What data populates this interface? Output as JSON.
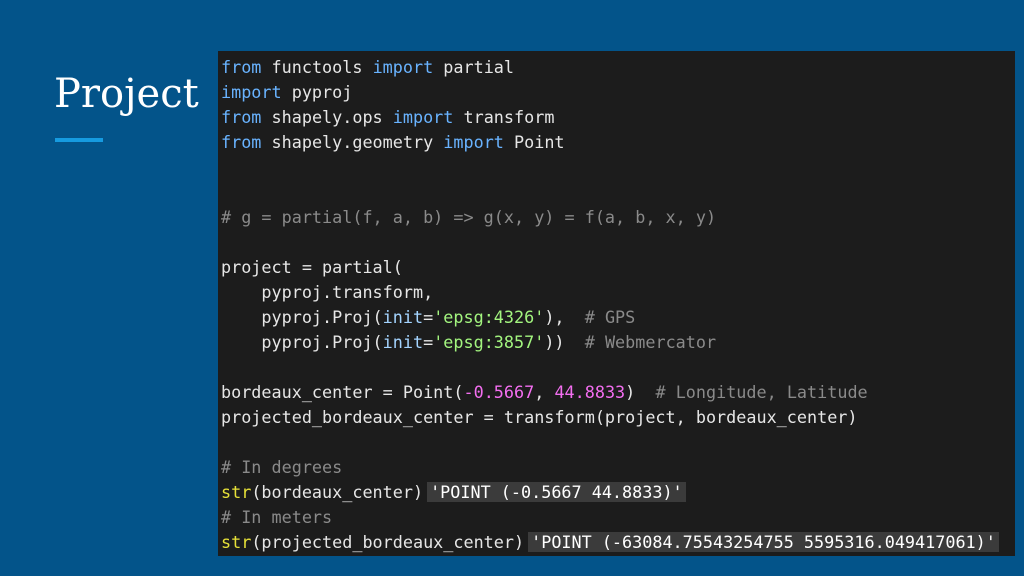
{
  "slide": {
    "title": "Project"
  },
  "code": {
    "line1": {
      "kw1": "from",
      "t1": " functools ",
      "kw2": "import",
      "t2": " partial"
    },
    "line2": {
      "kw1": "import",
      "t1": " pyproj"
    },
    "line3": {
      "kw1": "from",
      "t1": " shapely.ops ",
      "kw2": "import",
      "t2": " transform"
    },
    "line4": {
      "kw1": "from",
      "t1": " shapely.geometry ",
      "kw2": "import",
      "t2": " Point"
    },
    "line5": {
      "comment": "# g = partial(f, a, b) => g(x, y) = f(a, b, x, y)"
    },
    "line6": {
      "t1": "project = partial("
    },
    "line7": {
      "t1": "    pyproj.transform,"
    },
    "line8": {
      "t1": "    pyproj.Proj(",
      "arg": "init",
      "eq": "=",
      "str": "'epsg:4326'",
      "t2": "),  ",
      "comment": "# GPS"
    },
    "line9": {
      "t1": "    pyproj.Proj(",
      "arg": "init",
      "eq": "=",
      "str": "'epsg:3857'",
      "t2": "))  ",
      "comment": "# Webmercator"
    },
    "line10": {
      "t1": "bordeaux_center = Point(",
      "num1": "-0.5667",
      "sep": ", ",
      "num2": "44.8833",
      "t2": ")  ",
      "comment": "# Longitude, Latitude"
    },
    "line11": {
      "t1": "projected_bordeaux_center = transform(project, bordeaux_center)"
    },
    "line12": {
      "comment": "# In degrees"
    },
    "line13": {
      "fn": "str",
      "t1": "(bordeaux_center)",
      "out": "'POINT (-0.5667 44.8833)'"
    },
    "line14": {
      "comment": "# In meters"
    },
    "line15": {
      "fn": "str",
      "t1": "(projected_bordeaux_center)",
      "out": "'POINT (-63084.75543254755 5595316.049417061)'"
    }
  },
  "colors": {
    "background": "#03548a",
    "accent": "#169be0",
    "code_background": "#1c1c1c",
    "keyword": "#69b3ff",
    "comment": "#8a8a8a",
    "string": "#a3f57f",
    "number": "#f36ef0",
    "builtin": "#e6e038"
  }
}
